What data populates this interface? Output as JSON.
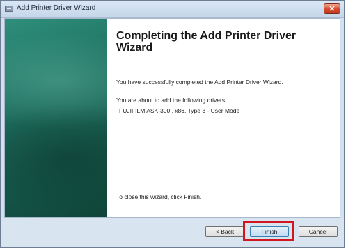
{
  "window": {
    "title": "Add Printer Driver Wizard",
    "close_glyph": "✕"
  },
  "wizard": {
    "heading": "Completing the Add Printer Driver Wizard",
    "success_text": "You have successfully completed the Add Printer Driver Wizard.",
    "about_text": "You are about to add the following drivers:",
    "driver_entry": "FUJIFILM ASK-300    , x86, Type 3 - User Mode",
    "close_hint": "To close this wizard, click Finish."
  },
  "buttons": {
    "back_label": "< Back",
    "finish_label": "Finish",
    "cancel_label": "Cancel"
  },
  "colors": {
    "highlight": "#d0171f",
    "banner": "#1f7262"
  }
}
